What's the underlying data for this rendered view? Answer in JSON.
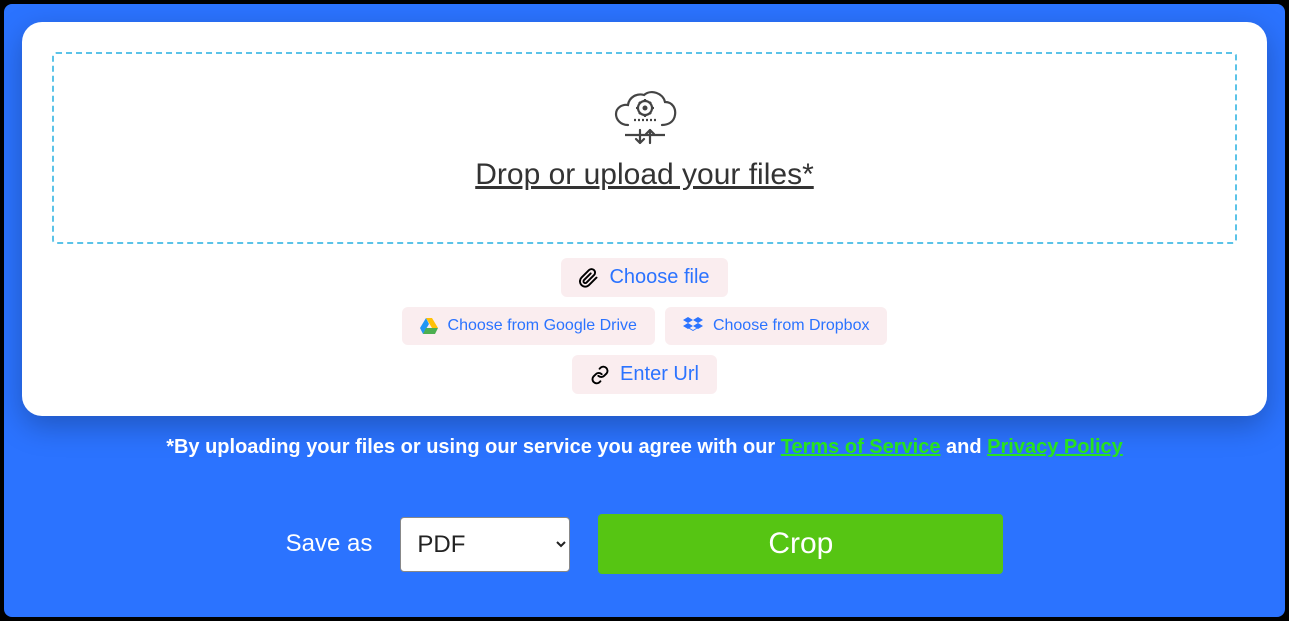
{
  "dropzone": {
    "title": "Drop or upload your files*"
  },
  "buttons": {
    "choose_file": "Choose file",
    "google_drive": "Choose from Google Drive",
    "dropbox": "Choose from Dropbox",
    "enter_url": "Enter Url"
  },
  "disclaimer": {
    "prefix": "*By uploading your files or using our service you agree with our ",
    "tos": "Terms of Service",
    "middle": " and ",
    "privacy": "Privacy Policy"
  },
  "action": {
    "save_as_label": "Save as",
    "format_value": "PDF",
    "crop_label": "Crop"
  }
}
